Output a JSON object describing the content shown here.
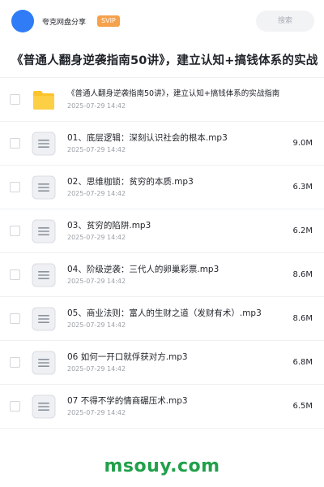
{
  "header": {
    "app_name": "夸克网盘分享",
    "badge": "SVIP",
    "search_placeholder": "搜索"
  },
  "title": "《普通人翻身逆袭指南50讲》，建立认知+搞钱体系的实战",
  "items": [
    {
      "type": "folder",
      "name": "《普通人翻身逆袭指南50讲》，建立认知+搞钱体系的实战指南",
      "date": "2025-07-29 14:42",
      "size": ""
    },
    {
      "type": "audio",
      "name": "01、底层逻辑：深刻认识社会的根本.mp3",
      "date": "2025-07-29 14:42",
      "size": "9.0M"
    },
    {
      "type": "audio",
      "name": "02、思维枷锁：贫穷的本质.mp3",
      "date": "2025-07-29 14:42",
      "size": "6.3M"
    },
    {
      "type": "audio",
      "name": "03、贫穷的陷阱.mp3",
      "date": "2025-07-29 14:42",
      "size": "6.2M"
    },
    {
      "type": "audio",
      "name": "04、阶级逆袭：三代人的卵巢彩票.mp3",
      "date": "2025-07-29 14:42",
      "size": "8.6M"
    },
    {
      "type": "audio",
      "name": "05、商业法则：富人的生财之道（发财有术）.mp3",
      "date": "2025-07-29 14:42",
      "size": "8.6M"
    },
    {
      "type": "audio",
      "name": "06 如何一开口就俘获对方.mp3",
      "date": "2025-07-29 14:42",
      "size": "6.8M"
    },
    {
      "type": "audio",
      "name": "07 不得不学的情商碾压术.mp3",
      "date": "2025-07-29 14:42",
      "size": "6.5M"
    }
  ],
  "watermark": "msouy.com",
  "colors": {
    "avatar": "#2f7cf6",
    "badge": "#f6a14c",
    "folder": "#fcc42a",
    "watermark": "#21a04a"
  }
}
